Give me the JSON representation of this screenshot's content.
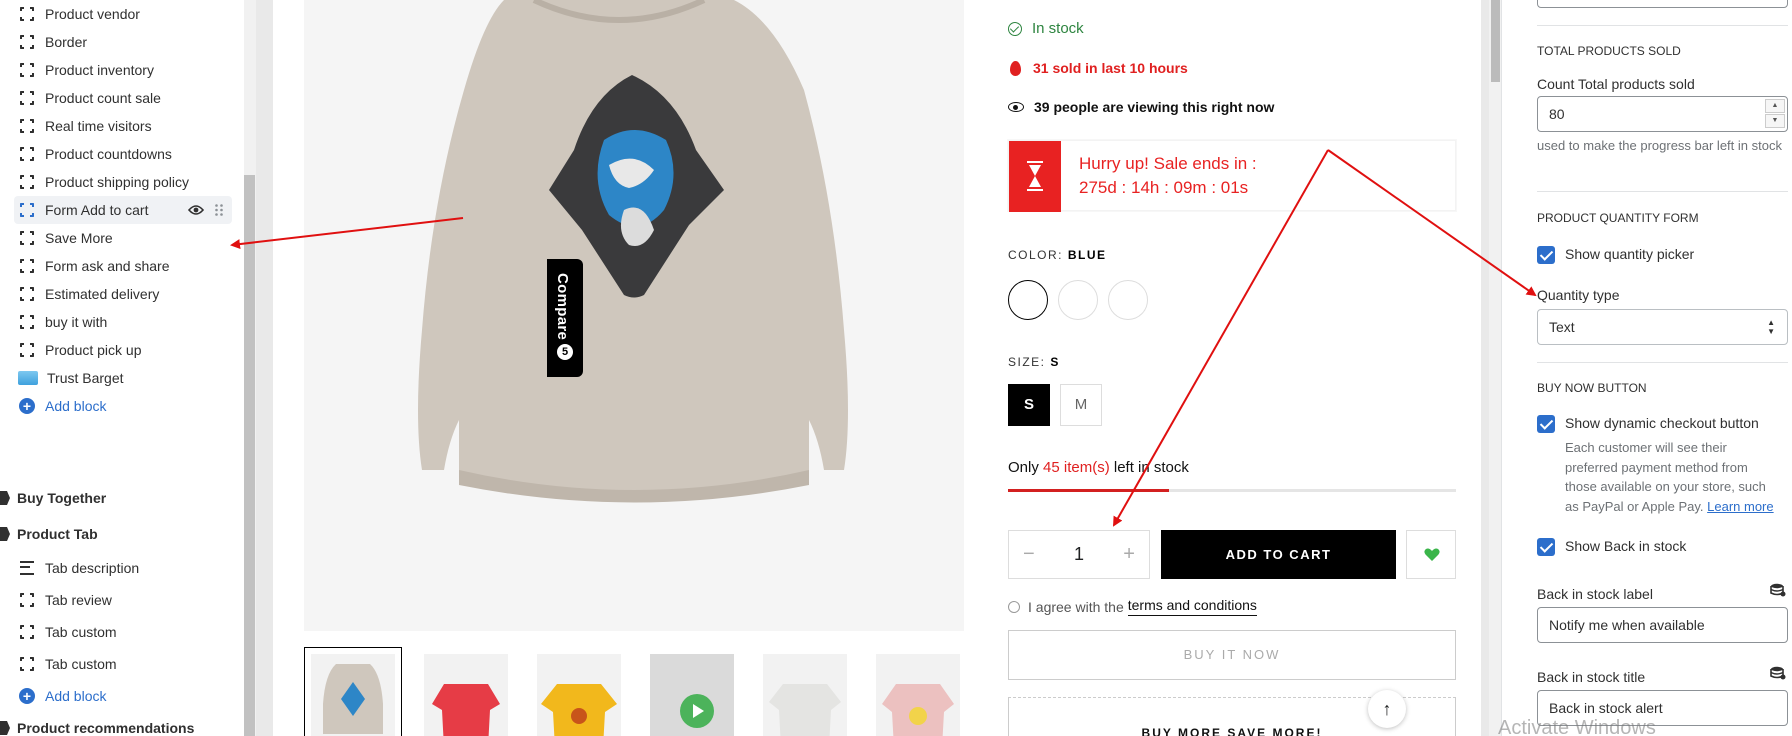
{
  "sidebar": {
    "blocks": [
      {
        "label": "Product vendor"
      },
      {
        "label": "Border"
      },
      {
        "label": "Product inventory"
      },
      {
        "label": "Product count sale"
      },
      {
        "label": "Real time visitors"
      },
      {
        "label": "Product countdowns"
      },
      {
        "label": "Product shipping policy"
      },
      {
        "label": "Form Add to cart"
      },
      {
        "label": "Save More"
      },
      {
        "label": "Form ask and share"
      },
      {
        "label": "Estimated delivery"
      },
      {
        "label": "buy it with"
      },
      {
        "label": "Product pick up"
      },
      {
        "label": "Trust Barget"
      }
    ],
    "add_block_label": "Add block",
    "section_buy_together": "Buy Together",
    "section_product_tab": "Product Tab",
    "tab_blocks": [
      {
        "label": "Tab description"
      },
      {
        "label": "Tab review"
      },
      {
        "label": "Tab custom"
      },
      {
        "label": "Tab custom"
      }
    ],
    "section_product_recommendations": "Product recommendations"
  },
  "preview": {
    "compare_label": "Compare",
    "compare_count": "5",
    "in_stock": "In stock",
    "sold_text": "31 sold in last 10 hours",
    "viewing_text": "39 people are viewing this right now",
    "sale_title": "Hurry up! Sale ends in :",
    "sale_countdown": "275d : 14h : 09m : 01s",
    "color_label": "COLOR:",
    "color_value": "BLUE",
    "size_label": "SIZE:",
    "size_value": "S",
    "sizes": [
      "S",
      "M"
    ],
    "stock_only": "Only",
    "stock_count": "45 item(s)",
    "stock_suffix": "left in stock",
    "stock_progress": 0.36,
    "quantity": "1",
    "qty_minus": "−",
    "qty_plus": "+",
    "add_to_cart": "ADD TO CART",
    "agree_prefix": "I agree with the",
    "agree_link": "terms and conditions",
    "buy_now": "BUY IT NOW",
    "buy_more": "BUY MORE SAVE MORE!",
    "back_to_top": "↑"
  },
  "right_panel": {
    "total_sold_heading": "TOTAL PRODUCTS SOLD",
    "count_label": "Count Total products sold",
    "count_value": "80",
    "count_help": "used to make the progress bar left in stock",
    "qty_form_heading": "PRODUCT QUANTITY FORM",
    "show_qty_picker": "Show quantity picker",
    "qty_type_label": "Quantity type",
    "qty_type_value": "Text",
    "buy_now_heading": "BUY NOW BUTTON",
    "show_dynamic": "Show dynamic checkout button",
    "dynamic_desc": "Each customer will see their preferred payment method from those available on your store, such as PayPal or Apple Pay.",
    "learn_more": "Learn more",
    "show_back_in_stock": "Show Back in stock",
    "back_label_label": "Back in stock label",
    "back_label_value": "Notify me when available",
    "back_title_label": "Back in stock title",
    "back_title_value": "Back in stock alert"
  },
  "watermark": "Activate Windows",
  "colors": {
    "accent_blue": "#2c6ecb",
    "sale_red": "#e82222",
    "stock_green": "#2e8540",
    "annotation_red": "#e01010"
  },
  "icons": [
    "bracket-block-icon",
    "eye-icon",
    "drag-handle-icon",
    "add-circle-icon",
    "section-caret-icon",
    "lines-icon",
    "check-circle-icon",
    "fire-icon",
    "hourglass-icon",
    "heart-icon",
    "database-icon",
    "checkbox-icon",
    "select-arrows-icon",
    "arrow-up-icon"
  ]
}
